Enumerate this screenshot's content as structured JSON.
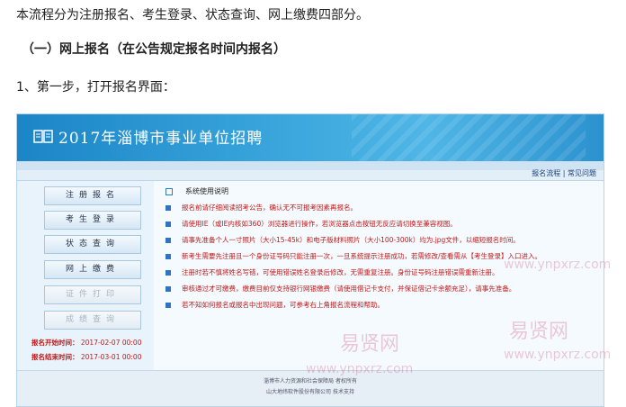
{
  "article": {
    "intro": "本流程分为注册报名、考生登录、状态查询、网上缴费四部分。",
    "section_title": "（一）网上报名（在公告规定报名时间内报名）",
    "step": "1、第一步，打开报名界面："
  },
  "site": {
    "title": "2017年淄博市事业单位招聘",
    "top_links": [
      "报名流程",
      "常见问题"
    ],
    "top_separator": "|",
    "side_buttons": [
      {
        "label": "注册报名",
        "enabled": true
      },
      {
        "label": "考生登录",
        "enabled": true
      },
      {
        "label": "状态查询",
        "enabled": true
      },
      {
        "label": "网上缴费",
        "enabled": true
      },
      {
        "label": "证件打印",
        "enabled": false
      },
      {
        "label": "成绩查询",
        "enabled": false
      }
    ],
    "reg_start_label": "报名开始时间：",
    "reg_start_value": "2017-02-07 00:00",
    "reg_end_label": "报名结束时间：",
    "reg_end_value": "2017-03-01 00:00",
    "notice_title": "系统使用说明",
    "notices": [
      "报名前请仔细阅读招考公告，确认无不可报考因素再报名。",
      "请使用IE（或IE内核如360）浏览器进行操作，若浏览器点击按钮无反应请切换至兼容视图。",
      "请事先准备个人一寸照片（大小15-45k）和电子版材料照片（大小100-300k）均为.jpg文件，以缩短报名时间。",
      "新考生需要先注册且一个身份证号码只能注册一次，一旦系统提示注册成功，若需修改/查看需从【考生登录】入口进入。",
      "注册时若不慎将姓名写错，可使用错误姓名登录后修改，无需重复注册。身份证号码注册错误需重新注册。",
      "审核通过才可缴费，缴费目前仅支持银行网银缴费（请使用借记卡支付，并保证借记卡余额充足），请事先准备。",
      "若不知如何报名或报名中出现问题，可参考右上角报名流程和帮助。"
    ],
    "footer_line1": "淄博市人力资源和社会保障局  者权所有",
    "footer_line2": "山大地纬软件股份有限公司  技术支持"
  },
  "watermarks": [
    "易贤网",
    "www.ynpxrz.com",
    "易贤网",
    "www.ynpxrz.com"
  ],
  "colors": {
    "banner": "#2c92cf",
    "accent_red": "#c01818",
    "link": "#1a3f7a"
  }
}
